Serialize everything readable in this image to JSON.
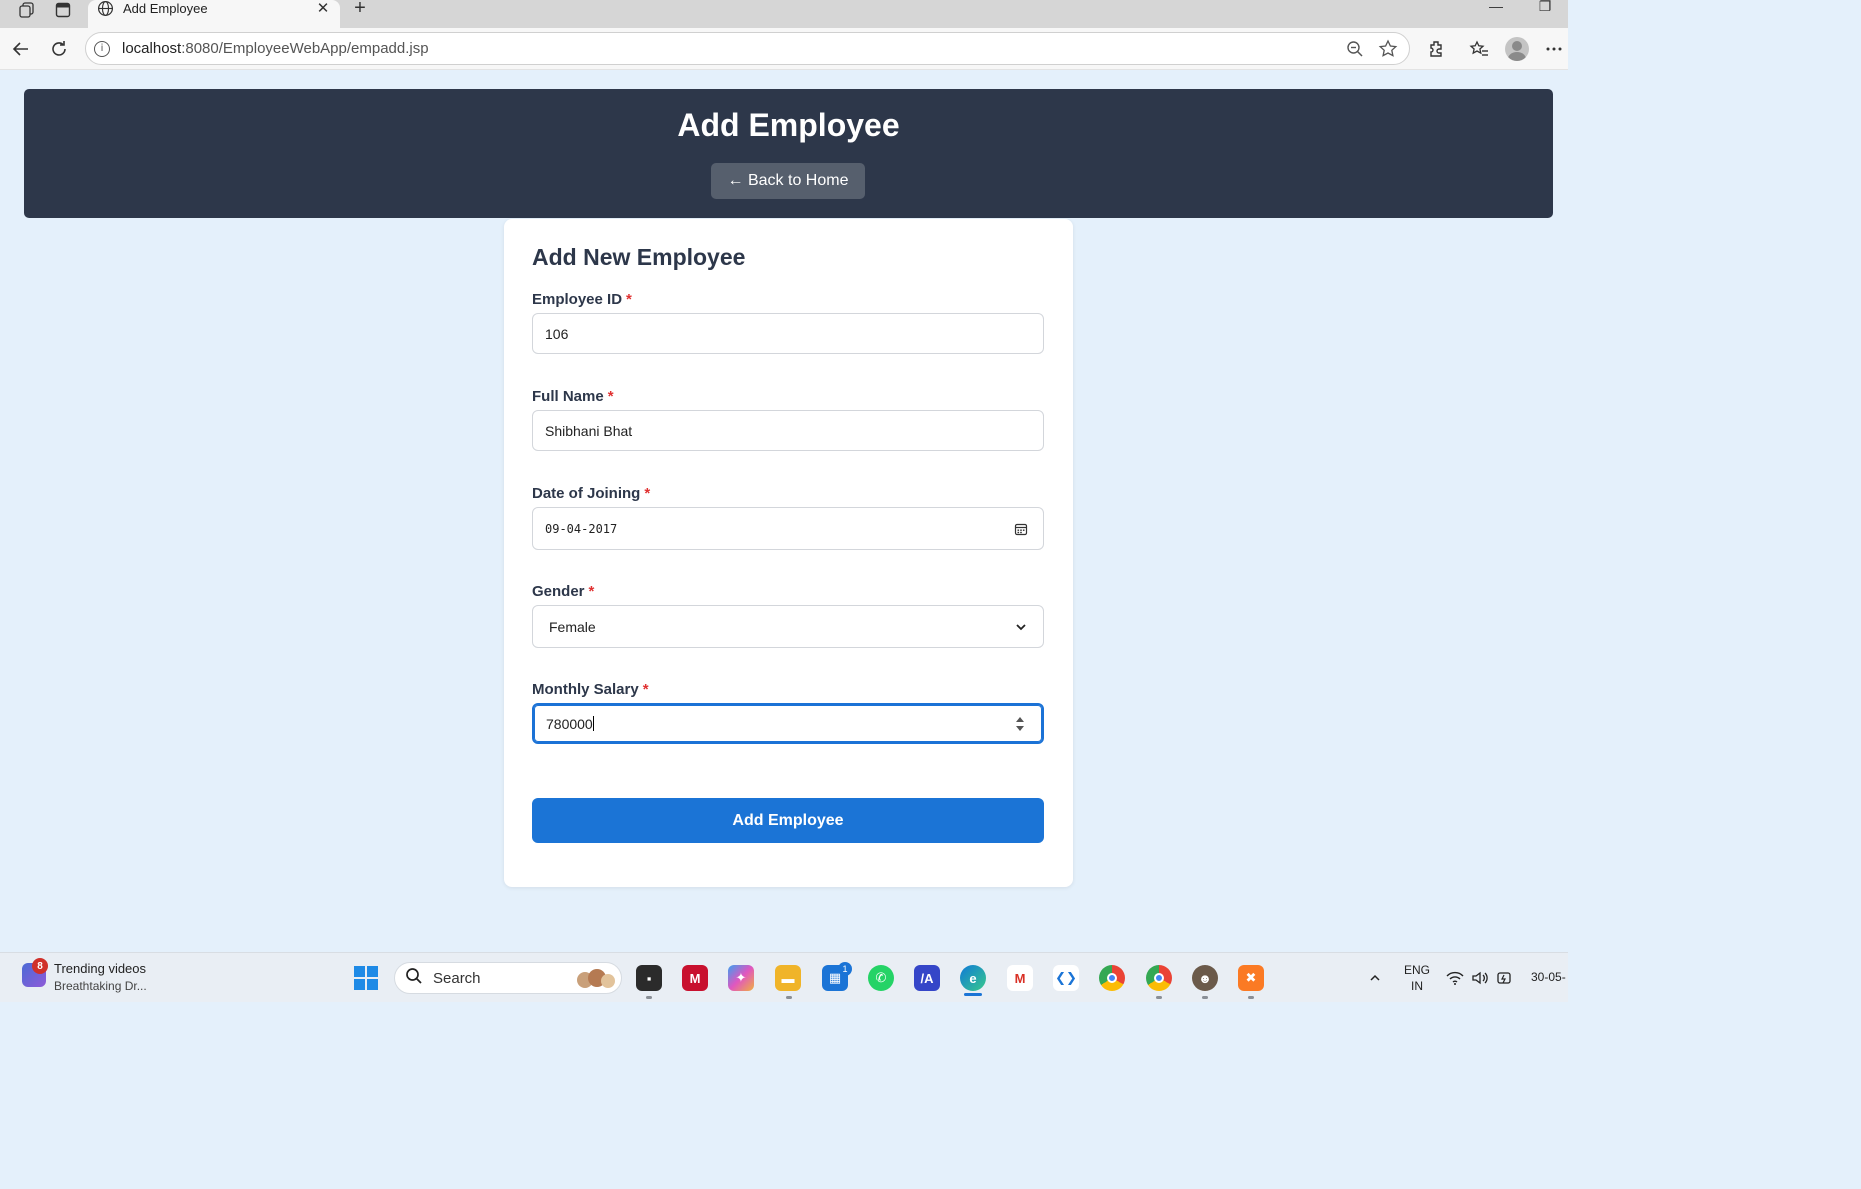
{
  "browser": {
    "tab_title": "Add Employee",
    "url_host": "localhost",
    "url_path": ":8080/EmployeeWebApp/empadd.jsp"
  },
  "header": {
    "title": "Add Employee",
    "back_button": "← Back to Home"
  },
  "form": {
    "title": "Add New Employee",
    "required_mark": "*",
    "fields": [
      {
        "label": "Employee ID",
        "value": "106",
        "type": "number"
      },
      {
        "label": "Full Name",
        "value": "Shibhani Bhat",
        "type": "text"
      },
      {
        "label": "Date of Joining",
        "value": "09-04-2017",
        "type": "date"
      },
      {
        "label": "Gender",
        "value": "Female",
        "type": "select"
      },
      {
        "label": "Monthly Salary",
        "value": "780000",
        "type": "number",
        "focused": true
      }
    ],
    "submit_label": "Add Employee"
  },
  "taskbar": {
    "news_badge": "8",
    "news_title": "Trending videos",
    "news_subtitle": "Breathtaking Dr...",
    "search_label": "Search",
    "store_badge": "1",
    "lang_line1": "ENG",
    "lang_line2": "IN",
    "date_partial": "30-05-"
  },
  "colors": {
    "header_bg": "#2d374a",
    "page_bg": "#e4f0fb",
    "accent": "#1b74d6",
    "required": "#e03131"
  }
}
